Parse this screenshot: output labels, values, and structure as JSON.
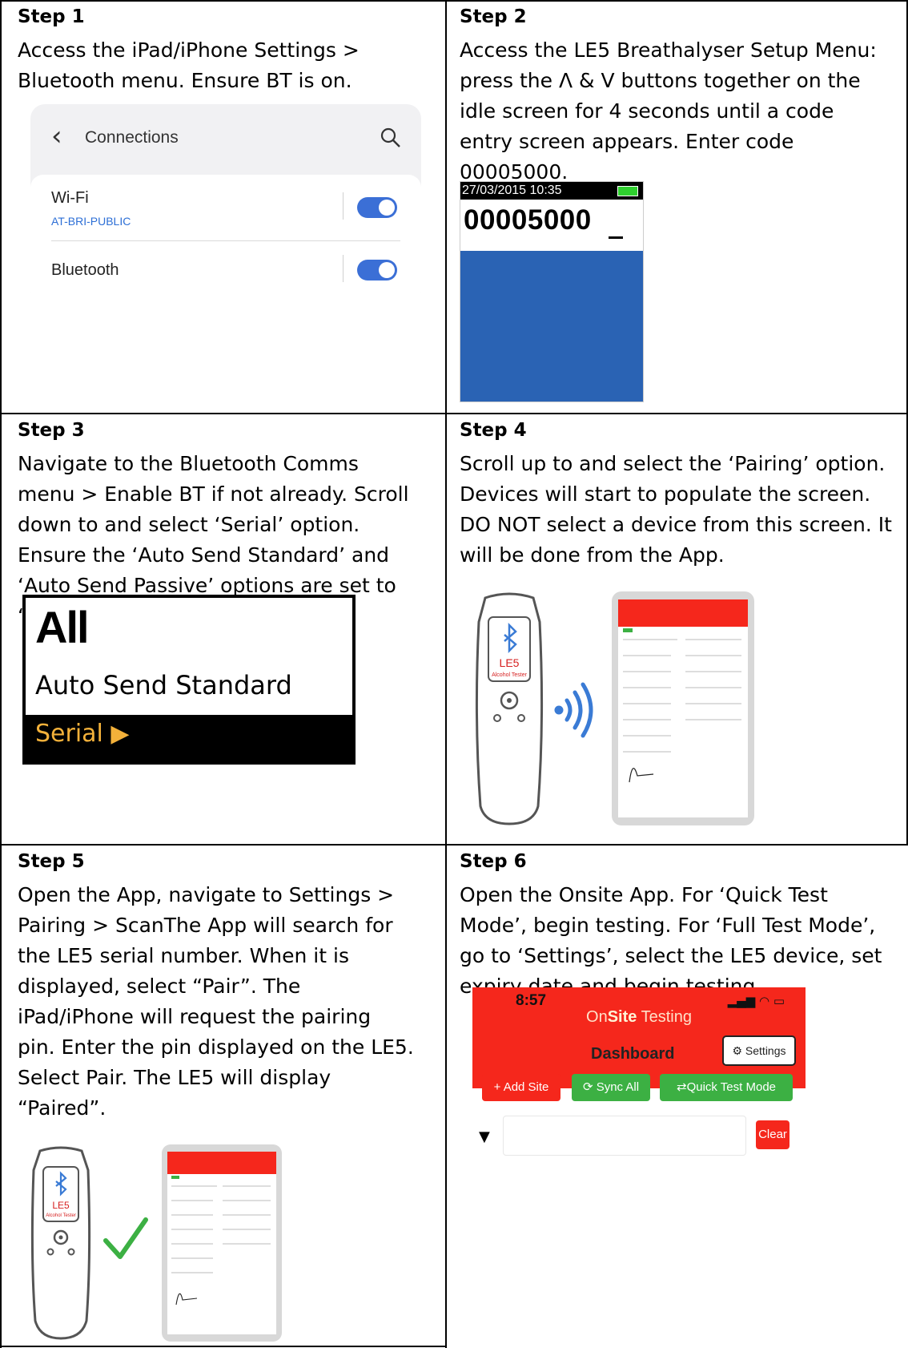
{
  "steps": [
    {
      "title": "Step 1",
      "text": "Access the iPad/iPhone Settings >\nBluetooth menu. Ensure BT is on.",
      "connections": {
        "back_icon": "chevron-left-icon",
        "title": "Connections",
        "search_icon": "search-icon",
        "items": [
          {
            "label": "Wi-Fi",
            "sub": "AT-BRI-PUBLIC",
            "on": true
          },
          {
            "label": "Bluetooth",
            "sub": "",
            "on": true
          }
        ],
        "toggle_color": "#3b6fd6"
      }
    },
    {
      "title": "Step 2",
      "text": "Access the LE5 Breathalyser Setup Menu:\npress the Λ & V buttons together on the\nidle screen for 4 seconds until a code\nentry screen appears. Enter code\n00005000.",
      "device_screen": {
        "datetime": "27/03/2015 10:35",
        "code": "00005000",
        "battery_color": "#2fd02f",
        "screen_color": "#2a63b4"
      }
    },
    {
      "title": "Step 3",
      "text": "Navigate to the Bluetooth Comms\nmenu > Enable BT if not already. Scroll\ndown to and select ‘Serial’ option.\nEnsure the ‘Auto Send Standard’ and\n‘Auto Send Passive’ options are set to\n‘All’ if that option is required",
      "lcd": {
        "value": "All",
        "label": "Auto Send Standard",
        "menu_item": "Serial ▶",
        "menu_color": "#f3b13a"
      }
    },
    {
      "title": "Step 4",
      "text": "Scroll up to and select the ‘Pairing’ option.\nDevices will start to populate the screen.\nDO NOT select a device from this screen. It\nwill be done from the App.",
      "breathalyser_label": "LE5",
      "breathalyser_sub": "Alcohol Tester",
      "signal_icon": "wireless-signal-icon"
    },
    {
      "title": "Step 5",
      "text": "Open the App, navigate to Settings >\nPairing > ScanThe App will search for\nthe LE5 serial number. When it is\ndisplayed, select “Pair”. The\niPad/iPhone will request the pairing\npin. Enter the pin displayed on the LE5.\nSelect Pair. The LE5 will display\n“Paired”.",
      "breathalyser_label": "LE5",
      "breathalyser_sub": "Alcohol Tester",
      "check_icon": "checkmark-icon",
      "check_color": "#3cb043"
    },
    {
      "title": "Step 6",
      "text": "Open the Onsite App. For ‘Quick Test\nMode’, begin testing. For ‘Full Test Mode’,\ngo to ‘Settings’, select the LE5 device, set\nexpiry date and begin testing.",
      "app": {
        "time": "8:57",
        "brand_1": "On",
        "brand_2": "Site",
        "brand_3": "Testing",
        "title": "Dashboard",
        "settings": "Settings",
        "buttons": [
          "+ Add Site",
          "Sync All",
          "Quick Test Mode"
        ],
        "clear": "Clear",
        "header_color": "#f5271c",
        "button_colors": [
          "#f5271c",
          "#3cb043",
          "#3cb043"
        ],
        "settings_icon": "gear-icon",
        "sync_icon": "sync-icon",
        "swap_icon": "swap-arrows-icon",
        "filter_icon": "filter-icon"
      }
    }
  ]
}
